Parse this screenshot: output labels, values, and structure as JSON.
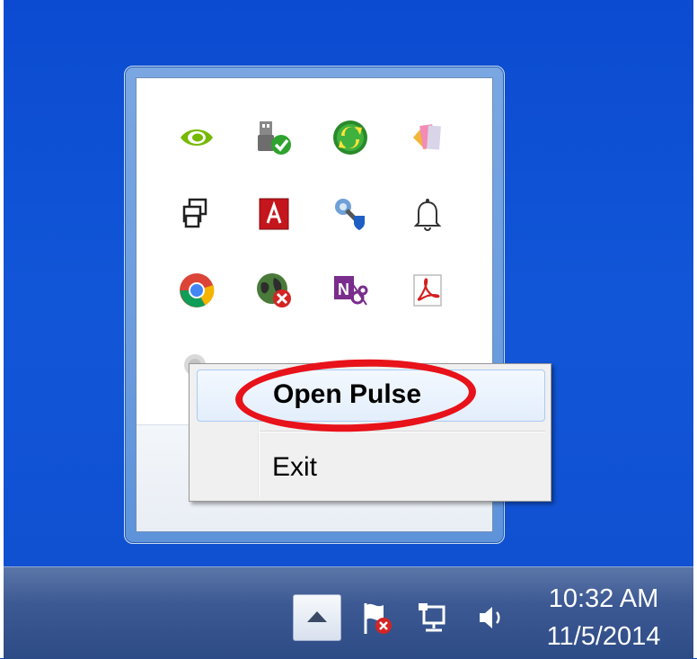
{
  "tray_overflow": {
    "icons": [
      {
        "name": "nvidia-icon"
      },
      {
        "name": "usb-safely-remove-icon"
      },
      {
        "name": "sync-icon"
      },
      {
        "name": "color-sticky-icon"
      },
      {
        "name": "windows-display-icon"
      },
      {
        "name": "adobe-icon"
      },
      {
        "name": "security-shield-icon"
      },
      {
        "name": "notification-bell-icon"
      },
      {
        "name": "chrome-icon"
      },
      {
        "name": "network-disconnected-globe-icon"
      },
      {
        "name": "onenote-clip-icon"
      },
      {
        "name": "acrobat-icon"
      },
      {
        "name": "pulse-icon"
      }
    ]
  },
  "context_menu": {
    "open_label": "Open Pulse",
    "exit_label": "Exit"
  },
  "taskbar": {
    "show_hidden_icon": "chevron-up-icon",
    "icons": [
      "action-center-flag-icon",
      "network-icon",
      "volume-icon"
    ],
    "time": "10:32 AM",
    "date": "11/5/2014"
  },
  "colors": {
    "desktop": "#0f4fcf",
    "highlight_ring": "#e8121a",
    "menu_hover": "#e3eefc"
  }
}
